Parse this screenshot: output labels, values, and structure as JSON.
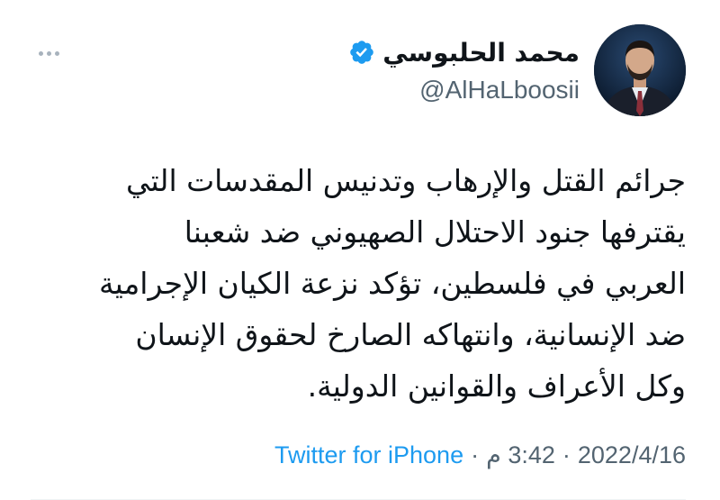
{
  "author": {
    "display_name": "محمد الحلبوسي",
    "handle": "@AlHaLboosii",
    "verified_icon": "verified-badge-icon",
    "avatar_icon": "profile-photo"
  },
  "tweet": {
    "lines": [
      "جرائم القتل والإرهاب وتدنيس المقدسات التي",
      "يقترفها جنود الاحتلال الصهيوني ضد شعبنا",
      "العربي في فلسطين، تؤكد نزعة الكيان الإجرامية",
      "ضد الإنسانية، وانتهاكه الصارخ لحقوق الإنسان",
      "وكل الأعراف والقوانين الدولية."
    ]
  },
  "meta": {
    "date": "2022/4/16",
    "separator": "·",
    "time": "3:42 م",
    "source": "Twitter for iPhone"
  },
  "menu": {
    "icon": "more-options-icon"
  },
  "colors": {
    "accent": "#1d9bf0",
    "text": "#0f1419",
    "secondary": "#536471"
  }
}
